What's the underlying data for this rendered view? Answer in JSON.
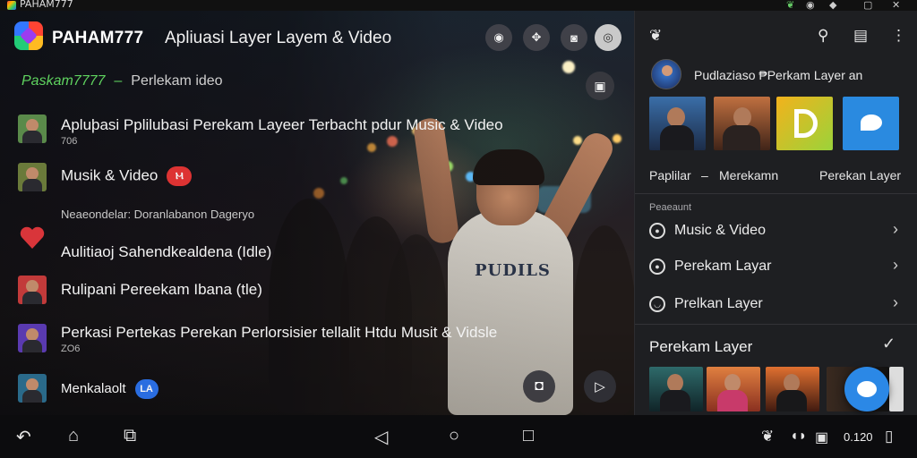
{
  "window": {
    "title": "PAHAM777"
  },
  "header": {
    "brand": "PAHAM777",
    "title": "Apliuasi Layer Layem & Video",
    "buttons": [
      "chat-icon",
      "puzzle-icon",
      "camera-edit-icon",
      "settings-icon"
    ]
  },
  "subtitle": {
    "brand": "Paskam7777",
    "sep": "–",
    "text": "Perlekam ideo"
  },
  "list": [
    {
      "title": "Apluþasi Pplilubasi Perekam Layeer Terbacht pdur Music & Video",
      "sub": "706"
    },
    {
      "title": "Musik & Video",
      "badge": "Ⲙ"
    },
    {
      "title": "Aulitiaoj Sahendkealdena (Idle)"
    },
    {
      "title": "Rulipani Pereekam Ibana (tle)"
    },
    {
      "title": "Perkasi Pertekas Perekan Perlorsisier tellalit Htdu Musit & Vidsle",
      "sub": "ZO6"
    },
    {
      "title": "Menkalaolt",
      "badge": "LA"
    }
  ],
  "note": "Neaeondelar: Doranlabanon Dageryo",
  "panel": {
    "user": "Pudlaziaso ₱Perkam Layer an",
    "captions": [
      "Paplilar",
      "–",
      "Merekamn",
      "Perekan Layer"
    ],
    "section": "Peaeaunt",
    "rows": [
      {
        "label": "Music & Video"
      },
      {
        "label": "Perekam Layar"
      },
      {
        "label": "Prelkan Layer"
      }
    ],
    "list_title": "Perekam Layer"
  },
  "navbar": {
    "clock": "0.120"
  }
}
